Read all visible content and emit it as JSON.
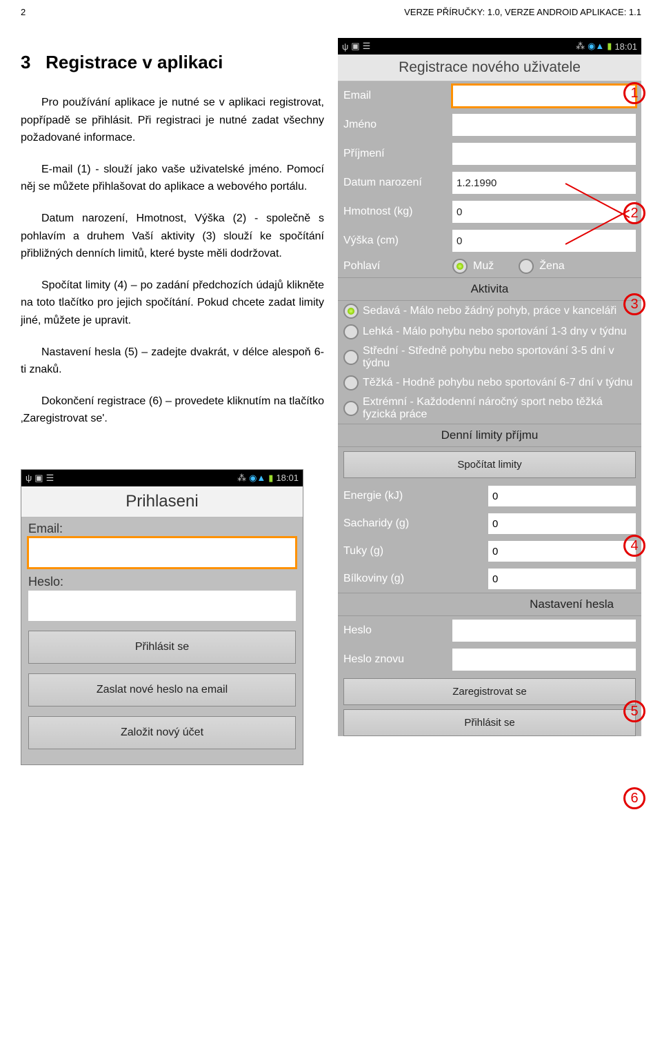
{
  "page_number": "2",
  "header_right": "VERZE PŘÍRUČKY: 1.0, VERZE ANDROID APLIKACE: 1.1",
  "section_number": "3",
  "section_title": "Registrace v aplikaci",
  "para1": "Pro používání aplikace je nutné se v aplikaci registrovat, popřípadě se přihlásit. Při registraci je nutné zadat všechny požadované informace.",
  "para2": "E-mail (1) - slouží jako vaše uživatelské jméno. Pomocí něj se můžete přihlašovat do aplikace a webového portálu.",
  "para3": "Datum narození, Hmotnost, Výška (2) - společně s pohlavím a druhem Vaší aktivity (3) slouží ke spočítání přibližných denních limitů, které byste měli dodržovat.",
  "para4": "Spočítat limity (4) – po zadání předchozích údajů klikněte na toto tlačítko pro jejich spočítání. Pokud chcete zadat limity jiné, můžete je upravit.",
  "para5": "Nastavení hesla (5) – zadejte dvakrát, v délce alespoň 6-ti znaků.",
  "para6": "Dokončení registrace (6) – provedete kliknutím na tlačítko ‚Zaregistrovat se'.",
  "status_time": "18:01",
  "reg": {
    "title": "Registrace nového uživatele",
    "email_label": "Email",
    "jmeno_label": "Jméno",
    "prijmeni_label": "Příjmení",
    "datum_label": "Datum narození",
    "datum_value": "1.2.1990",
    "hmotnost_label": "Hmotnost (kg)",
    "hmotnost_value": "0",
    "vyska_label": "Výška (cm)",
    "vyska_value": "0",
    "pohlavi_label": "Pohlaví",
    "muz": "Muž",
    "zena": "Žena",
    "aktivita_header": "Aktivita",
    "act1": "Sedavá - Málo nebo žádný pohyb, práce v kanceláři",
    "act2": "Lehká - Málo pohybu nebo sportování 1-3 dny v týdnu",
    "act3": "Střední - Středně pohybu nebo sportování 3-5 dní v týdnu",
    "act4": "Těžká - Hodně pohybu nebo sportování 6-7 dní v týdnu",
    "act5": "Extrémní - Každodenní náročný sport nebo těžká fyzická práce",
    "limits_header": "Denní limity příjmu",
    "btn_limits": "Spočítat limity",
    "energie": "Energie (kJ)",
    "sacharidy": "Sacharidy (g)",
    "tuky": "Tuky (g)",
    "bilkoviny": "Bílkoviny (g)",
    "zero": "0",
    "heslo_header": "Nastavení hesla",
    "heslo": "Heslo",
    "heslo_znovu": "Heslo znovu",
    "btn_reg": "Zaregistrovat se",
    "btn_login": "Přihlásit se"
  },
  "login": {
    "title": "Prihlaseni",
    "email": "Email:",
    "heslo": "Heslo:",
    "btn_login": "Přihlásit se",
    "btn_newpw": "Zaslat nové heslo na email",
    "btn_newacc": "Založit nový účet"
  },
  "annotations": {
    "a1": "1",
    "a2": "2",
    "a3": "3",
    "a4": "4",
    "a5": "5",
    "a6": "6"
  }
}
